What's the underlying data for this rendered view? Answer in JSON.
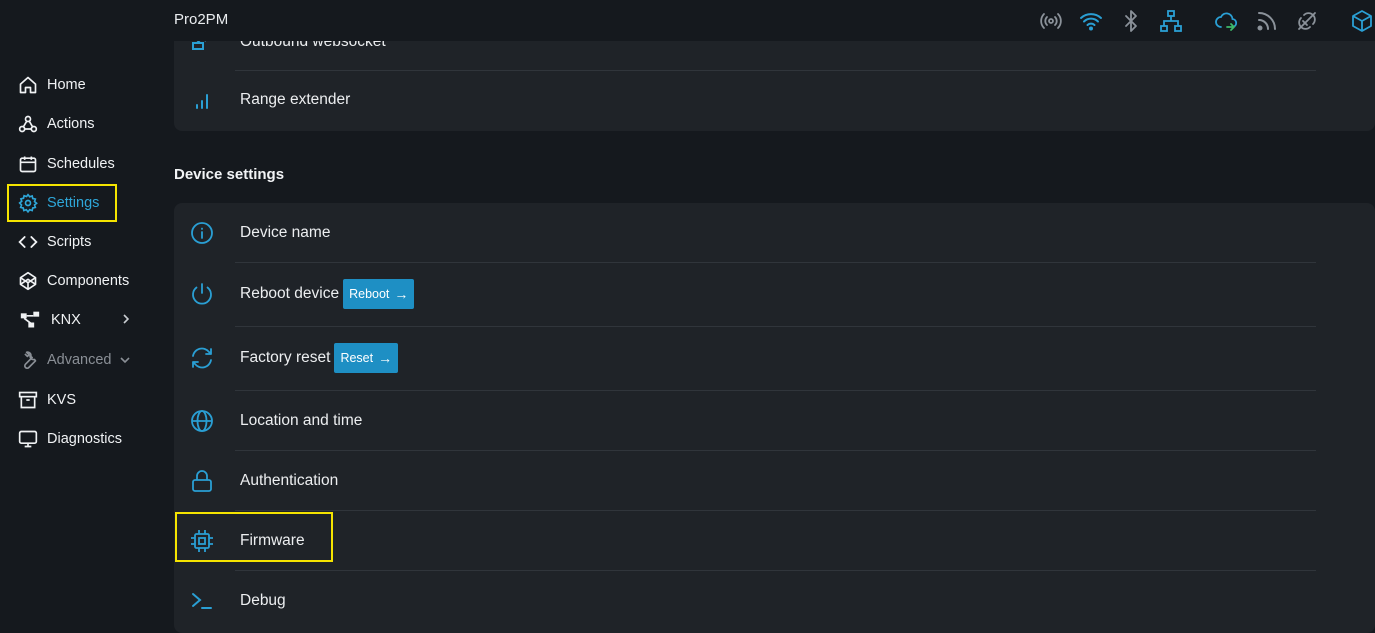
{
  "app": {
    "title": "Pro2PM"
  },
  "status_icons": [
    "broadcast-icon",
    "wifi-icon",
    "bluetooth-icon",
    "ethernet-icon",
    "cloud-sync-icon",
    "rss-icon",
    "link-off-icon",
    "package-icon"
  ],
  "sidebar": {
    "items": [
      {
        "label": "Home",
        "icon": "home-icon"
      },
      {
        "label": "Actions",
        "icon": "webhook-icon"
      },
      {
        "label": "Schedules",
        "icon": "calendar-icon"
      },
      {
        "label": "Settings",
        "icon": "gear-icon",
        "active": true
      },
      {
        "label": "Scripts",
        "icon": "code-icon"
      },
      {
        "label": "Components",
        "icon": "components-icon"
      },
      {
        "label": "KNX",
        "icon": "network-icon",
        "expandable": true
      },
      {
        "label": "Advanced",
        "icon": "wrench-icon",
        "expandable": true,
        "disabled": true
      },
      {
        "label": "KVS",
        "icon": "archive-icon"
      },
      {
        "label": "Diagnostics",
        "icon": "monitor-icon"
      }
    ]
  },
  "network_settings": {
    "rows": [
      {
        "label": "Outbound websocket",
        "icon": "websocket-icon"
      },
      {
        "label": "Range extender",
        "icon": "signal-bars-icon"
      }
    ]
  },
  "device_settings": {
    "title": "Device settings",
    "rows": [
      {
        "label": "Device name",
        "icon": "info-icon"
      },
      {
        "label": "Reboot device",
        "icon": "power-icon",
        "button": "Reboot"
      },
      {
        "label": "Factory reset",
        "icon": "refresh-icon",
        "button": "Reset"
      },
      {
        "label": "Location and time",
        "icon": "globe-icon"
      },
      {
        "label": "Authentication",
        "icon": "lock-icon"
      },
      {
        "label": "Firmware",
        "icon": "chip-icon"
      },
      {
        "label": "Debug",
        "icon": "terminal-icon"
      }
    ]
  },
  "colors": {
    "accent": "#2a9fd4",
    "highlight": "#f5e400",
    "background": "#15191e",
    "card": "#1f2328"
  }
}
